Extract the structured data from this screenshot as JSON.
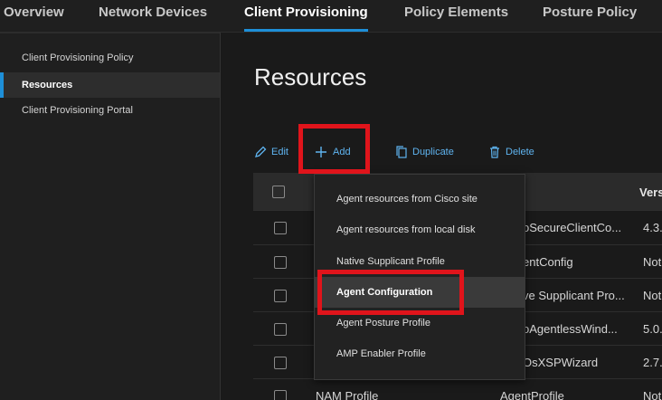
{
  "topnav": {
    "tabs": [
      {
        "label": "Overview"
      },
      {
        "label": "Network Devices"
      },
      {
        "label": "Client Provisioning"
      },
      {
        "label": "Policy Elements"
      },
      {
        "label": "Posture Policy"
      }
    ]
  },
  "sidebar": {
    "items": [
      {
        "label": "Client Provisioning Policy"
      },
      {
        "label": "Resources"
      },
      {
        "label": "Client Provisioning Portal"
      }
    ]
  },
  "main": {
    "title": "Resources"
  },
  "toolbar": {
    "edit_label": "Edit",
    "add_label": "Add",
    "duplicate_label": "Duplicate",
    "delete_label": "Delete"
  },
  "table": {
    "header": {
      "version": "Vers"
    },
    "rows": [
      {
        "type": "oSecureClientCo...",
        "version": "4.3."
      },
      {
        "type": "entConfig",
        "version": "Not"
      },
      {
        "type": "ve Supplicant Pro...",
        "version": "Not"
      },
      {
        "type": "oAgentlessWind...",
        "version": "5.0."
      },
      {
        "type": "OsXSPWizard",
        "version": "2.7."
      },
      {
        "name": "NAM Profile",
        "type": "AgentProfile",
        "version": "Not"
      }
    ]
  },
  "add_menu": {
    "items": [
      {
        "label": "Agent resources from Cisco site"
      },
      {
        "label": "Agent resources from local disk"
      },
      {
        "label": "Native Supplicant Profile"
      },
      {
        "label": "Agent Configuration"
      },
      {
        "label": "Agent Posture Profile"
      },
      {
        "label": "AMP Enabler Profile"
      }
    ]
  },
  "colors": {
    "accent": "#1e8fd8",
    "link": "#5fb4f0",
    "highlight_box": "#e0141b",
    "background": "#1a1a1a"
  }
}
